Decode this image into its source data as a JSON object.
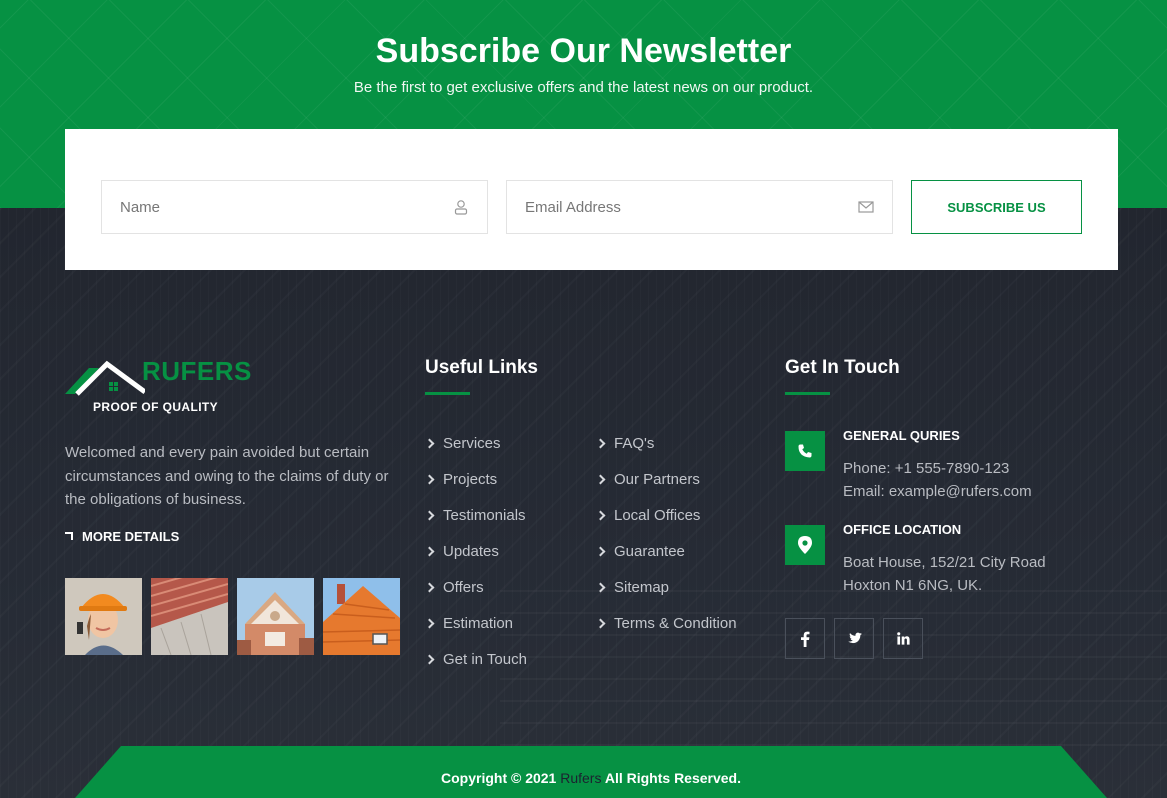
{
  "newsletter": {
    "title": "Subscribe Our Newsletter",
    "subtitle": "Be the first to get exclusive offers and the latest news on our product.",
    "name_placeholder": "Name",
    "email_placeholder": "Email Address",
    "button_label": "SUBSCRIBE US"
  },
  "brand": {
    "name": "RUFERS",
    "tagline": "PROOF OF QUALITY",
    "about": "Welcomed and every pain avoided but certain circumstances and owing to the claims of duty or the obligations of business.",
    "more_label": "MORE DETAILS"
  },
  "gallery": [
    "worker-in-hard-hat",
    "red-roof-tiles",
    "house-gable",
    "orange-tile-roof"
  ],
  "useful_links": {
    "heading": "Useful Links",
    "col1": [
      "Services",
      "Projects",
      "Testimonials",
      "Updates",
      "Offers",
      "Estimation",
      "Get in Touch"
    ],
    "col2": [
      "FAQ's",
      "Our Partners",
      "Local Offices",
      "Guarantee",
      "Sitemap",
      "Terms & Condition"
    ]
  },
  "contact": {
    "heading": "Get In Touch",
    "general": {
      "title": "GENERAL QURIES",
      "phone": "Phone: +1 555-7890-123",
      "email": "Email: example@rufers.com"
    },
    "office": {
      "title": "OFFICE LOCATION",
      "line1": "Boat House, 152/21 City Road",
      "line2": "Hoxton N1 6NG, UK."
    },
    "social": [
      {
        "icon": "facebook-icon",
        "glyph": "f"
      },
      {
        "icon": "twitter-icon",
        "glyph": "🐦"
      },
      {
        "icon": "linkedin-icon",
        "glyph": "in"
      }
    ]
  },
  "footer": {
    "copyright_prefix": "Copyright © 2021",
    "copyright_brand": "Rufers",
    "copyright_suffix": "All Rights Reserved."
  },
  "colors": {
    "accent": "#069143",
    "dark_bg": "#222733",
    "text_muted": "#b9bcc2"
  }
}
